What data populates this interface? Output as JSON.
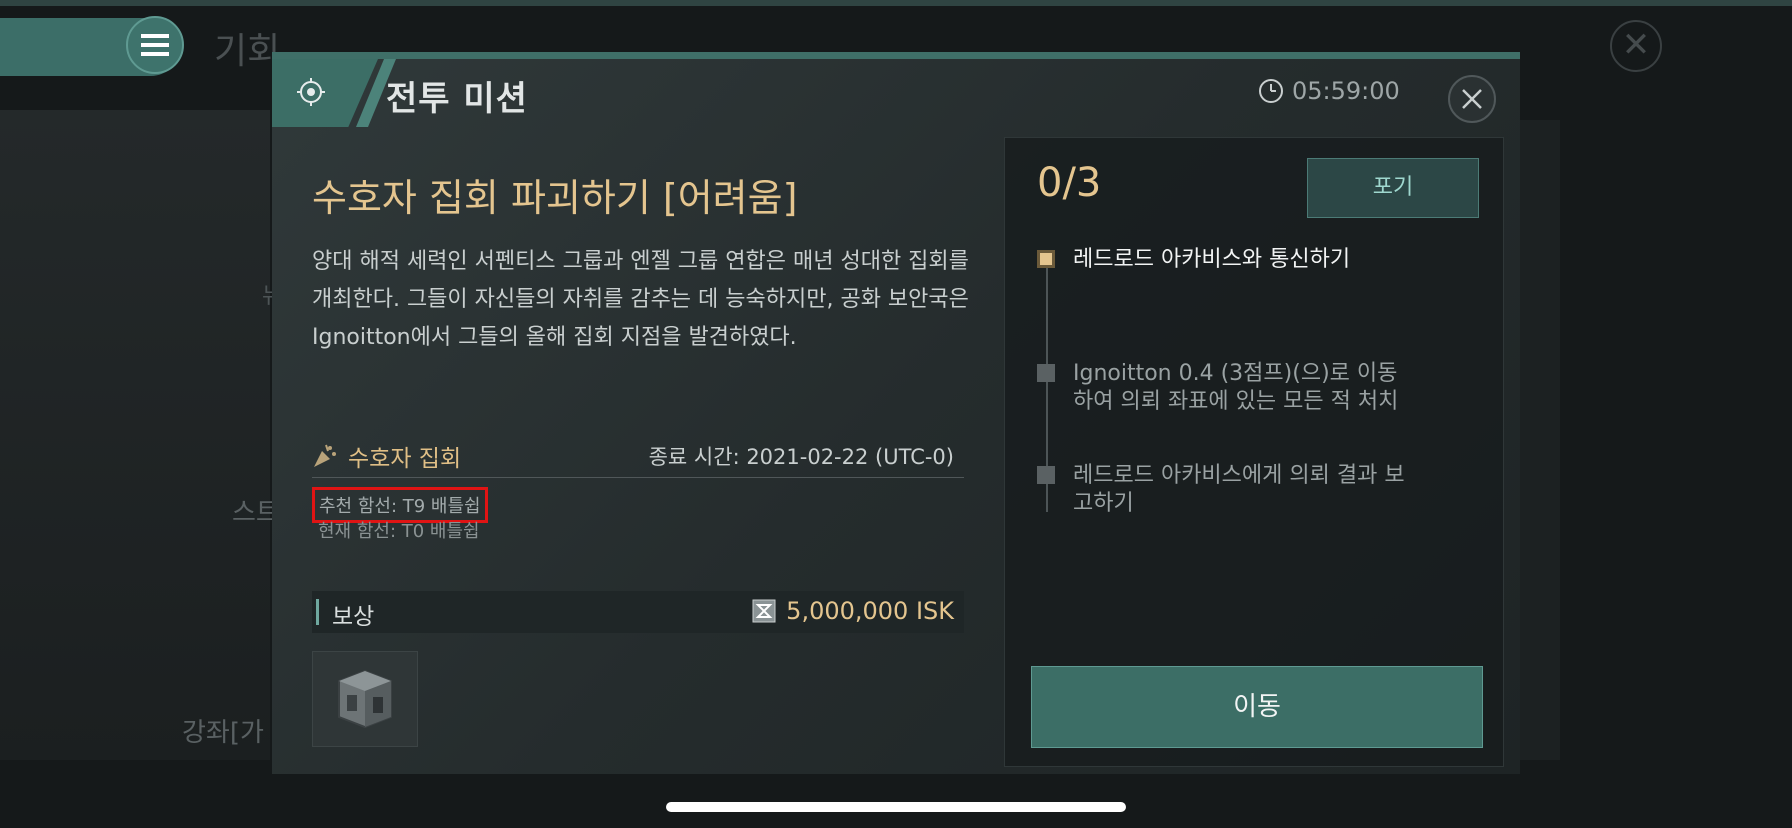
{
  "background": {
    "logo_text": "기회",
    "side_text_1": "스트",
    "side_text_2": "강좌[가",
    "side_text_3": "뉴"
  },
  "modal": {
    "title": "전투 미션",
    "timer": "05:59:00",
    "mission_title": "수호자 집회 파괴하기 [어려움]",
    "description": "양대 해적 세력인 서펜티스 그룹과 엔젤 그룹 연합은 매년 성대한 집회를 개최한다. 그들이 자신들의 자취를 감추는 데 능숙하지만, 공화 보안국은 Ignoitton에서 그들의 올해 집회 지점을 발견하였다.",
    "category": "수호자 집회",
    "end_time": "종료 시간: 2021-02-22 (UTC-0)",
    "recommended_ship": "추천 함선: T9 배틀쉽",
    "current_ship": "현재 함선: T0 배틀쉽",
    "reward_label": "보상",
    "reward_isk": "5,000,000 ISK"
  },
  "objectives": {
    "progress": "0/3",
    "giveup_label": "포기",
    "steps": [
      {
        "text": "레드로드 아카비스와 통신하기",
        "active": true
      },
      {
        "text": "Ignoitton 0.4 (3점프)(으)로 이동하여 의뢰 좌표에 있는 모든 적 처치",
        "active": false
      },
      {
        "text": "레드로드 아카비스에게 의뢰 결과 보고하기",
        "active": false
      }
    ],
    "move_label": "이동"
  },
  "colors": {
    "accent_teal": "#3c6e66",
    "gold": "#e4c58f",
    "highlight_red": "#e01414"
  }
}
